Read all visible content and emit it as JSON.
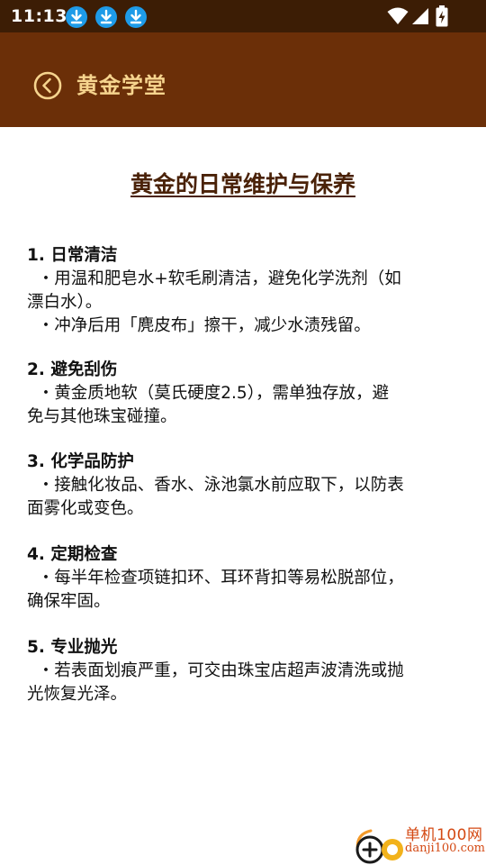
{
  "status_bar": {
    "time": "11:13",
    "notification_icons": [
      "download-icon",
      "download-icon",
      "download-icon"
    ],
    "system_icons": [
      "wifi-icon",
      "signal-icon",
      "battery-charging-icon"
    ]
  },
  "app_bar": {
    "title": "黄金学堂",
    "back_icon": "back-circle-icon"
  },
  "article": {
    "title": "黄金的日常维护与保养",
    "sections": [
      {
        "heading": "1. 日常清洁",
        "body": "  ・用温和肥皂水+软毛刷清洁，避免化学洗剂（如\n漂白水）。\n  ・冲净后用「麂皮布」擦干，减少水渍残留。"
      },
      {
        "heading": "2. 避免刮伤",
        "body": "  ・黄金质地软（莫氏硬度2.5），需单独存放，避\n免与其他珠宝碰撞。"
      },
      {
        "heading": "3. 化学品防护",
        "body": "  ・接触化妆品、香水、泳池氯水前应取下，以防表\n面雾化或变色。"
      },
      {
        "heading": "4. 定期检查",
        "body": "  ・每半年检查项链扣环、耳环背扣等易松脱部位，\n确保牢固。"
      },
      {
        "heading": "5. 专业抛光",
        "body": "  ・若表面划痕严重，可交由珠宝店超声波清洗或抛\n光恢复光泽。"
      }
    ]
  },
  "watermark": {
    "brand_line": "单机100网",
    "url_line": "danji100.com"
  },
  "colors": {
    "status_bar": "#3c1d05",
    "app_bar": "#6b2f08",
    "title_gold": "#f6d48e",
    "article_title": "#4a2208",
    "watermark": "#d44a14",
    "download_badge": "#1e9be8"
  }
}
